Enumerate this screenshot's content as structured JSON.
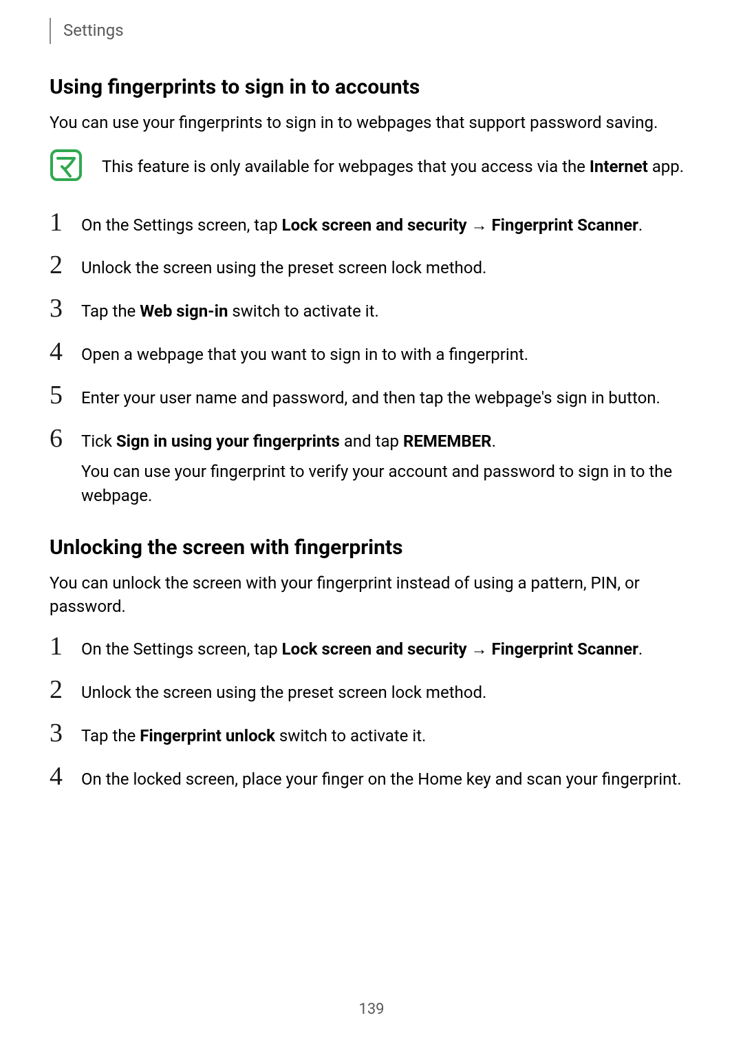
{
  "header": {
    "breadcrumb": "Settings"
  },
  "section1": {
    "heading": "Using fingerprints to sign in to accounts",
    "intro": "You can use your fingerprints to sign in to webpages that support password saving.",
    "note": {
      "prefix": "This feature is only available for webpages that you access via the ",
      "bold": "Internet",
      "suffix": " app."
    },
    "steps": [
      {
        "num": "1",
        "pre": "On the Settings screen, tap ",
        "b1": "Lock screen and security",
        "arrow": " → ",
        "b2": "Fingerprint Scanner",
        "post": "."
      },
      {
        "num": "2",
        "text": "Unlock the screen using the preset screen lock method."
      },
      {
        "num": "3",
        "pre": "Tap the ",
        "b1": "Web sign-in",
        "post": " switch to activate it."
      },
      {
        "num": "4",
        "text": "Open a webpage that you want to sign in to with a fingerprint."
      },
      {
        "num": "5",
        "text": "Enter your user name and password, and then tap the webpage's sign in button."
      },
      {
        "num": "6",
        "pre": "Tick ",
        "b1": "Sign in using your fingerprints",
        "mid": " and tap ",
        "b2": "REMEMBER",
        "post": ".",
        "extra": "You can use your fingerprint to verify your account and password to sign in to the webpage."
      }
    ]
  },
  "section2": {
    "heading": "Unlocking the screen with fingerprints",
    "intro": "You can unlock the screen with your fingerprint instead of using a pattern, PIN, or password.",
    "steps": [
      {
        "num": "1",
        "pre": "On the Settings screen, tap ",
        "b1": "Lock screen and security",
        "arrow": " → ",
        "b2": "Fingerprint Scanner",
        "post": "."
      },
      {
        "num": "2",
        "text": "Unlock the screen using the preset screen lock method."
      },
      {
        "num": "3",
        "pre": "Tap the ",
        "b1": "Fingerprint unlock",
        "post": " switch to activate it."
      },
      {
        "num": "4",
        "text": "On the locked screen, place your finger on the Home key and scan your fingerprint."
      }
    ]
  },
  "pageNumber": "139"
}
